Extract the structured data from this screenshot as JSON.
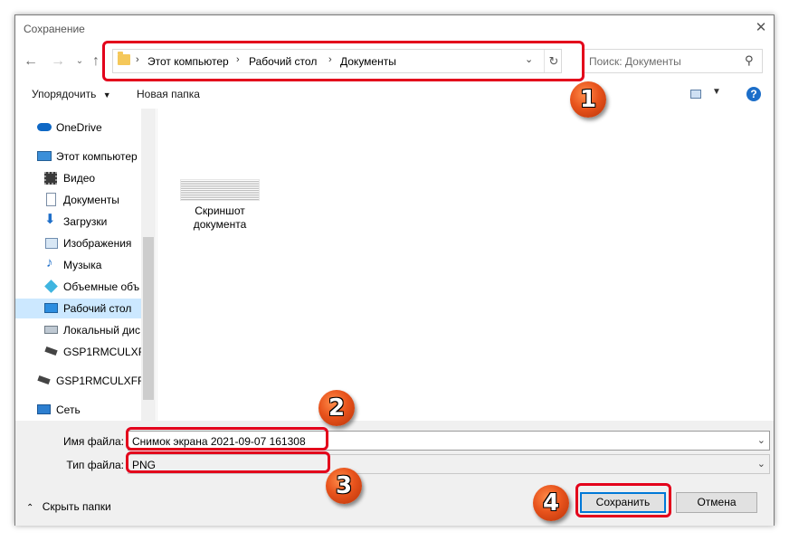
{
  "window": {
    "title": "Сохранение"
  },
  "address": {
    "crumbs": [
      "Этот компьютер",
      "Рабочий стол",
      "Документы"
    ]
  },
  "search": {
    "placeholder": "Поиск: Документы"
  },
  "toolbar": {
    "organize_label": "Упорядочить",
    "new_folder_label": "Новая папка",
    "help_label": "?"
  },
  "nav": {
    "items": [
      {
        "label": "OneDrive",
        "icon": "cloud-icon"
      },
      {
        "label": "Этот компьютер",
        "icon": "computer-icon"
      },
      {
        "label": "Видео",
        "icon": "video-icon"
      },
      {
        "label": "Документы",
        "icon": "document-icon"
      },
      {
        "label": "Загрузки",
        "icon": "download-icon"
      },
      {
        "label": "Изображения",
        "icon": "image-icon"
      },
      {
        "label": "Музыка",
        "icon": "music-icon"
      },
      {
        "label": "Объемные объ",
        "icon": "3d-objects-icon"
      },
      {
        "label": "Рабочий стол",
        "icon": "desktop-icon",
        "selected": true
      },
      {
        "label": "Локальный дис",
        "icon": "disk-icon"
      },
      {
        "label": "GSP1RMCULXFR",
        "icon": "drive-icon"
      },
      {
        "label": "GSP1RMCULXFRE",
        "icon": "drive-icon"
      },
      {
        "label": "Сеть",
        "icon": "network-icon"
      }
    ]
  },
  "files": [
    {
      "name_line1": "Скриншот",
      "name_line2": "документа"
    }
  ],
  "form": {
    "filename_label": "Имя файла:",
    "filename_value": "Снимок экрана 2021-09-07 161308",
    "filetype_label": "Тип файла:",
    "filetype_value": "PNG"
  },
  "footer": {
    "hide_folders_label": "Скрыть папки",
    "save_label": "Сохранить",
    "cancel_label": "Отмена"
  },
  "annotations": {
    "color": "#e3001b",
    "badges": [
      "1",
      "2",
      "3",
      "4"
    ]
  }
}
